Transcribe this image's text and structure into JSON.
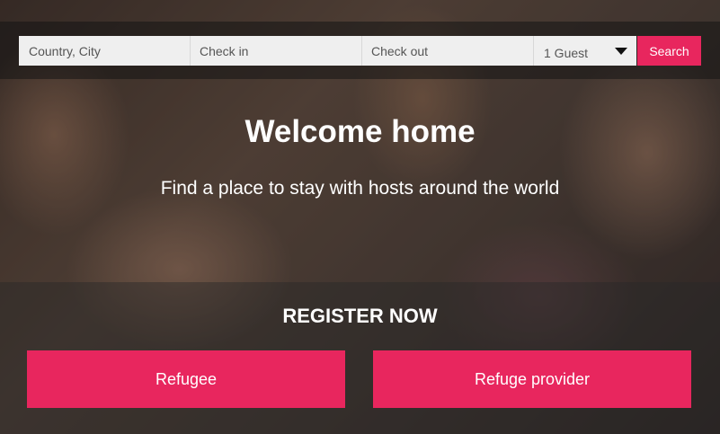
{
  "search": {
    "location_placeholder": "Country, City",
    "checkin_placeholder": "Check in",
    "checkout_placeholder": "Check out",
    "guests_selected": "1 Guest",
    "search_label": "Search"
  },
  "hero": {
    "title": "Welcome home",
    "subtitle": "Find a place to stay with hosts around the world"
  },
  "register": {
    "title": "REGISTER NOW",
    "refugee_label": "Refugee",
    "provider_label": "Refuge provider"
  },
  "colors": {
    "accent": "#e8265e",
    "field_bg": "#efefef"
  },
  "icons": {
    "dropdown": "chevron-down-icon"
  }
}
